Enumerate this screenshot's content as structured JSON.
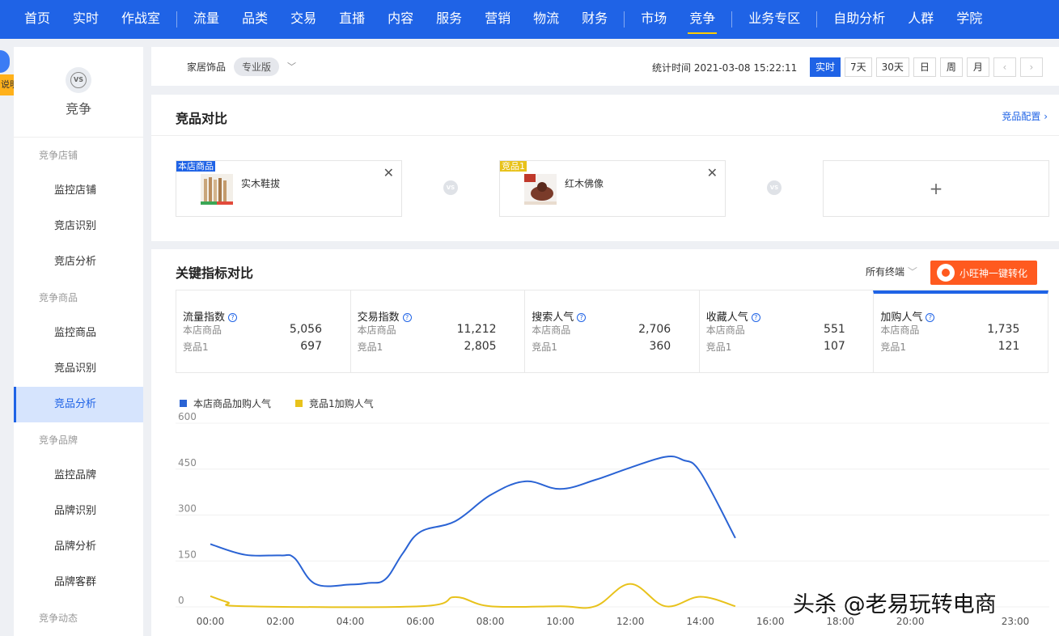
{
  "topnav": {
    "items": [
      {
        "label": "首页",
        "dot": false
      },
      {
        "label": "实时",
        "dot": false
      },
      {
        "label": "作战室",
        "dot": true
      },
      {
        "label": "流量",
        "dot": false
      },
      {
        "label": "品类",
        "dot": false
      },
      {
        "label": "交易",
        "dot": false
      },
      {
        "label": "直播",
        "dot": true
      },
      {
        "label": "内容",
        "dot": false
      },
      {
        "label": "服务",
        "dot": false
      },
      {
        "label": "营销",
        "dot": false
      },
      {
        "label": "物流",
        "dot": false
      },
      {
        "label": "财务",
        "dot": false
      },
      {
        "label": "市场",
        "dot": false
      },
      {
        "label": "竞争",
        "dot": false
      },
      {
        "label": "业务专区",
        "dot": false
      },
      {
        "label": "自助分析",
        "dot": false
      },
      {
        "label": "人群",
        "dot": false
      },
      {
        "label": "学院",
        "dot": false
      }
    ],
    "active_label": "竞争"
  },
  "side_tab_label": "说明",
  "sidebar": {
    "badge": "VS",
    "title": "竞争",
    "groups": [
      {
        "label": "竞争店铺",
        "items": [
          "监控店铺",
          "竞店识别",
          "竞店分析"
        ]
      },
      {
        "label": "竞争商品",
        "items": [
          "监控商品",
          "竞品识别",
          "竞品分析"
        ]
      },
      {
        "label": "竞争品牌",
        "items": [
          "监控品牌",
          "品牌识别",
          "品牌分析",
          "品牌客群"
        ]
      },
      {
        "label": "竞争动态",
        "items": []
      }
    ],
    "active_item": "竞品分析"
  },
  "filterbar": {
    "category": "家居饰品",
    "edition": "专业版",
    "stat_time": "统计时间 2021-03-08 15:22:11",
    "buttons": [
      "实时",
      "7天",
      "30天",
      "日",
      "周",
      "月"
    ],
    "active_button": "实时"
  },
  "compare": {
    "title": "竞品对比",
    "config_link": "竞品配置",
    "products": [
      {
        "tag": "本店商品",
        "tag_color": "#1f63e6",
        "name": "实木鞋拔"
      },
      {
        "tag": "竞品1",
        "tag_color": "#e8c21b",
        "name": "红木佛像"
      }
    ],
    "vs": "VS",
    "add": "+"
  },
  "indicators": {
    "title": "关键指标对比",
    "terminal": "所有终端",
    "convert_button": "小旺神一键转化",
    "metrics": [
      {
        "name": "流量指数",
        "self_label": "本店商品",
        "self_value": "5,056",
        "rival_label": "竞品1",
        "rival_value": "697"
      },
      {
        "name": "交易指数",
        "self_label": "本店商品",
        "self_value": "11,212",
        "rival_label": "竞品1",
        "rival_value": "2,805"
      },
      {
        "name": "搜索人气",
        "self_label": "本店商品",
        "self_value": "2,706",
        "rival_label": "竞品1",
        "rival_value": "360"
      },
      {
        "name": "收藏人气",
        "self_label": "本店商品",
        "self_value": "551",
        "rival_label": "竞品1",
        "rival_value": "107"
      },
      {
        "name": "加购人气",
        "self_label": "本店商品",
        "self_value": "1,735",
        "rival_label": "竞品1",
        "rival_value": "121"
      }
    ],
    "active_metric": "加购人气"
  },
  "chart_data": {
    "type": "line",
    "x_ticks": [
      "00:00",
      "02:00",
      "04:00",
      "06:00",
      "08:00",
      "10:00",
      "12:00",
      "14:00",
      "16:00",
      "18:00",
      "20:00",
      "23:00"
    ],
    "x_tick_hours": [
      0,
      2,
      4,
      6,
      8,
      10,
      12,
      14,
      16,
      18,
      20,
      23
    ],
    "x_range": [
      0,
      23
    ],
    "ylim": [
      0,
      600
    ],
    "y_ticks": [
      0,
      150,
      300,
      450,
      600
    ],
    "grid": true,
    "legend_position": "top-left",
    "series": [
      {
        "name": "本店商品加购人气",
        "color": "#2a63d4",
        "points": [
          [
            0,
            205
          ],
          [
            1,
            170
          ],
          [
            2,
            168
          ],
          [
            2.4,
            160
          ],
          [
            3,
            75
          ],
          [
            4,
            73
          ],
          [
            4.5,
            78
          ],
          [
            5,
            90
          ],
          [
            5.5,
            175
          ],
          [
            6,
            245
          ],
          [
            7,
            280
          ],
          [
            8,
            365
          ],
          [
            9,
            410
          ],
          [
            10,
            385
          ],
          [
            11,
            415
          ],
          [
            12,
            455
          ],
          [
            13,
            490
          ],
          [
            13.5,
            480
          ],
          [
            14,
            440
          ],
          [
            15,
            225
          ]
        ]
      },
      {
        "name": "竞品1加购人气",
        "color": "#e8c21b",
        "points": [
          [
            0,
            35
          ],
          [
            0.5,
            15
          ],
          [
            1,
            2
          ],
          [
            6,
            2
          ],
          [
            7,
            32
          ],
          [
            8,
            2
          ],
          [
            10,
            2
          ],
          [
            11,
            2
          ],
          [
            12,
            75
          ],
          [
            13,
            2
          ],
          [
            14,
            33
          ],
          [
            15,
            2
          ]
        ]
      }
    ]
  },
  "watermark": "头杀 @老易玩转电商"
}
